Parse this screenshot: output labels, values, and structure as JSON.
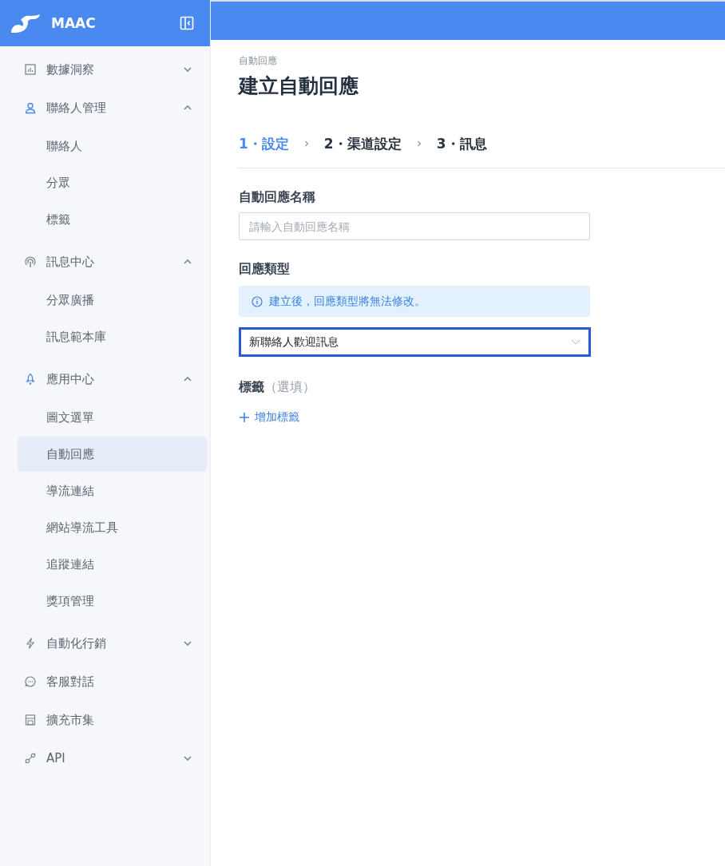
{
  "brand": {
    "name": "MAAC"
  },
  "nav": [
    {
      "label": "數據洞察",
      "expanded": false,
      "highlighted": false
    },
    {
      "label": "聯絡人管理",
      "expanded": true,
      "highlighted": true,
      "children": [
        {
          "label": "聯絡人",
          "selected": false
        },
        {
          "label": "分眾",
          "selected": false
        },
        {
          "label": "標籤",
          "selected": false
        }
      ]
    },
    {
      "label": "訊息中心",
      "expanded": true,
      "highlighted": false,
      "children": [
        {
          "label": "分眾廣播",
          "selected": false
        },
        {
          "label": "訊息範本庫",
          "selected": false
        }
      ]
    },
    {
      "label": "應用中心",
      "expanded": true,
      "highlighted": true,
      "children": [
        {
          "label": "圖文選單",
          "selected": false
        },
        {
          "label": "自動回應",
          "selected": true
        },
        {
          "label": "導流連結",
          "selected": false
        },
        {
          "label": "網站導流工具",
          "selected": false
        },
        {
          "label": "追蹤連結",
          "selected": false
        },
        {
          "label": "獎項管理",
          "selected": false
        }
      ]
    },
    {
      "label": "自動化行銷",
      "expanded": false,
      "highlighted": false
    },
    {
      "label": "客服對話",
      "highlighted": false
    },
    {
      "label": "擴充市集",
      "highlighted": false
    },
    {
      "label": "API",
      "expanded": false,
      "highlighted": false
    }
  ],
  "breadcrumb": "自動回應",
  "title": "建立自動回應",
  "steps": [
    {
      "label": "1・設定",
      "selected": true
    },
    {
      "label": "2・渠道設定",
      "selected": false
    },
    {
      "label": "3・訊息",
      "selected": false
    }
  ],
  "form": {
    "name_label": "自動回應名稱",
    "name_placeholder": "請輸入自動回應名稱",
    "type_label": "回應類型",
    "type_notice": "建立後，回應類型將無法修改。",
    "type_value": "新聯絡人歡迎訊息",
    "tags_label": "標籤",
    "tags_hint": "（選填）",
    "add_tag": "增加標籤"
  }
}
